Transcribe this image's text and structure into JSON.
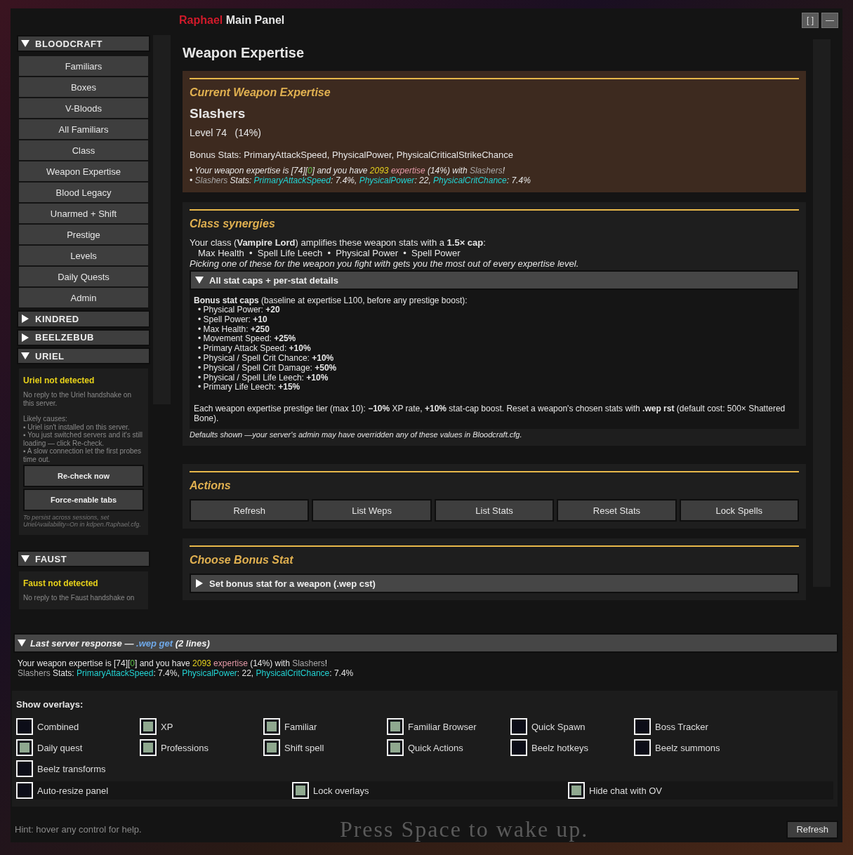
{
  "window": {
    "title_accent": "Raphael",
    "title": "Main Panel",
    "buttons": [
      "[ ]",
      "—"
    ]
  },
  "sidebar": {
    "groups": [
      {
        "label": "BLOODCRAFT",
        "expanded": true,
        "items": [
          "Familiars",
          "Boxes",
          "V-Bloods",
          "All Familiars",
          "Class",
          "Weapon Expertise",
          "Blood Legacy",
          "Unarmed + Shift",
          "Prestige",
          "Levels",
          "Daily Quests",
          "Admin"
        ]
      },
      {
        "label": "KINDRED",
        "expanded": false
      },
      {
        "label": "BEELZEBUB",
        "expanded": false
      },
      {
        "label": "URIEL",
        "expanded": true,
        "notice": {
          "title": "Uriel not detected",
          "body": [
            "No reply to the Uriel handshake on this server."
          ],
          "causes": [
            "Likely causes:",
            "▪ Uriel isn't installed on this server.",
            "▪ You just switched servers and it's still loading — click Re-check.",
            "▪ A slow connection let the first probes time out."
          ],
          "buttons": [
            "Re-check now",
            "Force-enable tabs"
          ],
          "footnote": "To persist across sessions, set UrielAvailability=On in kdpen.Raphael.cfg."
        }
      },
      {
        "label": "FAUST",
        "expanded": true,
        "notice": {
          "title": "Faust not detected",
          "body": [
            "No reply to the Faust handshake on"
          ]
        }
      }
    ]
  },
  "main": {
    "heading": "Weapon Expertise",
    "current": {
      "title": "Current Weapon Expertise",
      "weapon": "Slashers",
      "level": "Level 74   (14%)",
      "bonus": "Bonus Stats: PrimaryAttackSpeed, PhysicalPower, PhysicalCriticalStrikeChance",
      "lines": [
        [
          {
            "text": "• Your weapon expertise is [74]["
          },
          {
            "text": "0",
            "color": "#5fc24a"
          },
          {
            "text": "] and you have "
          },
          {
            "text": "2093 ",
            "color": "#e6d21e"
          },
          {
            "text": "expertise",
            "color": "#e59aa8"
          },
          {
            "text": " (14%) with "
          },
          {
            "text": "Slashers",
            "color": "#a8a8a8"
          },
          {
            "text": "!"
          }
        ],
        [
          {
            "text": "• "
          },
          {
            "text": "Slashers",
            "color": "#a8a8a8"
          },
          {
            "text": " Stats: "
          },
          {
            "text": "PrimaryAttackSpeed",
            "color": "#22d3d3"
          },
          {
            "text": ": 7.4%, "
          },
          {
            "text": "PhysicalPower",
            "color": "#22d3d3"
          },
          {
            "text": ": 22, "
          },
          {
            "text": "PhysicalCritChance",
            "color": "#22d3d3"
          },
          {
            "text": ": 7.4%"
          }
        ]
      ]
    },
    "synergies": {
      "title": "Class synergies",
      "intro": "Your class (**Vampire Lord**) amplifies these weapon stats with a **1.5× cap**:",
      "stats": "Max Health  •  Spell Life Leech  •  Physical Power  •  Spell Power",
      "note": "Picking one of these for the weapon you fight with gets you the most out of every expertise level.",
      "details": {
        "label": "All stat caps + per-stat details",
        "expanded": true,
        "heading": "**Bonus stat caps** (baseline at expertise L100, before any prestige boost):",
        "caps": [
          "• Physical Power: **+20**",
          "• Spell Power: **+10**",
          "• Max Health: **+250**",
          "• Movement Speed: **+25%**",
          "• Primary Attack Speed: **+10%**",
          "• Physical / Spell Crit Chance: **+10%**",
          "• Physical / Spell Crit Damage: **+50%**",
          "• Physical / Spell Life Leech: **+10%**",
          "• Primary Life Leech: **+15%**"
        ],
        "prestige": "Each weapon expertise prestige tier (max 10): **−10%** XP rate, **+10%** stat-cap boost. Reset a weapon's chosen stats with **.wep rst** (default cost: 500× Shattered Bone)."
      },
      "footnote": "Defaults shown —your server's admin may have overridden any of these values in Bloodcraft.cfg."
    },
    "actions": {
      "title": "Actions",
      "buttons": [
        "Refresh",
        "List Weps",
        "List Stats",
        "Reset Stats",
        "Lock Spells"
      ]
    },
    "choose": {
      "title": "Choose Bonus Stat",
      "label": "Set bonus stat for a weapon (.wep cst)",
      "expanded": false
    }
  },
  "response": {
    "expanded": true,
    "header": [
      {
        "text": "Last server response — "
      },
      {
        "text": ".wep get",
        "color": "#6fa8e8"
      },
      {
        "text": "  (2 lines)"
      }
    ],
    "lines": [
      [
        {
          "text": "Your weapon expertise is [74]["
        },
        {
          "text": "0",
          "color": "#5fc24a"
        },
        {
          "text": "] and you have "
        },
        {
          "text": "2093 ",
          "color": "#e6d21e"
        },
        {
          "text": "expertise",
          "color": "#e59aa8"
        },
        {
          "text": " (14%) with "
        },
        {
          "text": "Slashers",
          "color": "#a8a8a8"
        },
        {
          "text": "!"
        }
      ],
      [
        {
          "text": "Slashers",
          "color": "#a8a8a8"
        },
        {
          "text": " Stats: "
        },
        {
          "text": "PrimaryAttackSpeed",
          "color": "#22d3d3"
        },
        {
          "text": ": 7.4%, "
        },
        {
          "text": "PhysicalPower",
          "color": "#22d3d3"
        },
        {
          "text": ": 22, "
        },
        {
          "text": "PhysicalCritChance",
          "color": "#22d3d3"
        },
        {
          "text": ": 7.4%"
        }
      ]
    ]
  },
  "overlays": {
    "title": "Show overlays:",
    "items": [
      {
        "label": "Combined",
        "checked": false
      },
      {
        "label": "XP",
        "checked": true
      },
      {
        "label": "Familiar",
        "checked": true
      },
      {
        "label": "Familiar Browser",
        "checked": true
      },
      {
        "label": "Quick Spawn",
        "checked": false
      },
      {
        "label": "Boss Tracker",
        "checked": false
      },
      {
        "label": "Daily quest",
        "checked": true
      },
      {
        "label": "Professions",
        "checked": true
      },
      {
        "label": "Shift spell",
        "checked": true
      },
      {
        "label": "Quick Actions",
        "checked": true
      },
      {
        "label": "Beelz hotkeys",
        "checked": false
      },
      {
        "label": "Beelz summons",
        "checked": false
      },
      {
        "label": "Beelz transforms",
        "checked": false
      }
    ],
    "options": [
      {
        "label": "Auto-resize panel",
        "checked": false
      },
      {
        "label": "Lock overlays",
        "checked": true
      },
      {
        "label": "Hide chat with OV",
        "checked": true
      }
    ]
  },
  "footer": {
    "hint": "Hint: hover any control for help.",
    "background_text": "Press Space to wake up.",
    "button": "Refresh"
  }
}
